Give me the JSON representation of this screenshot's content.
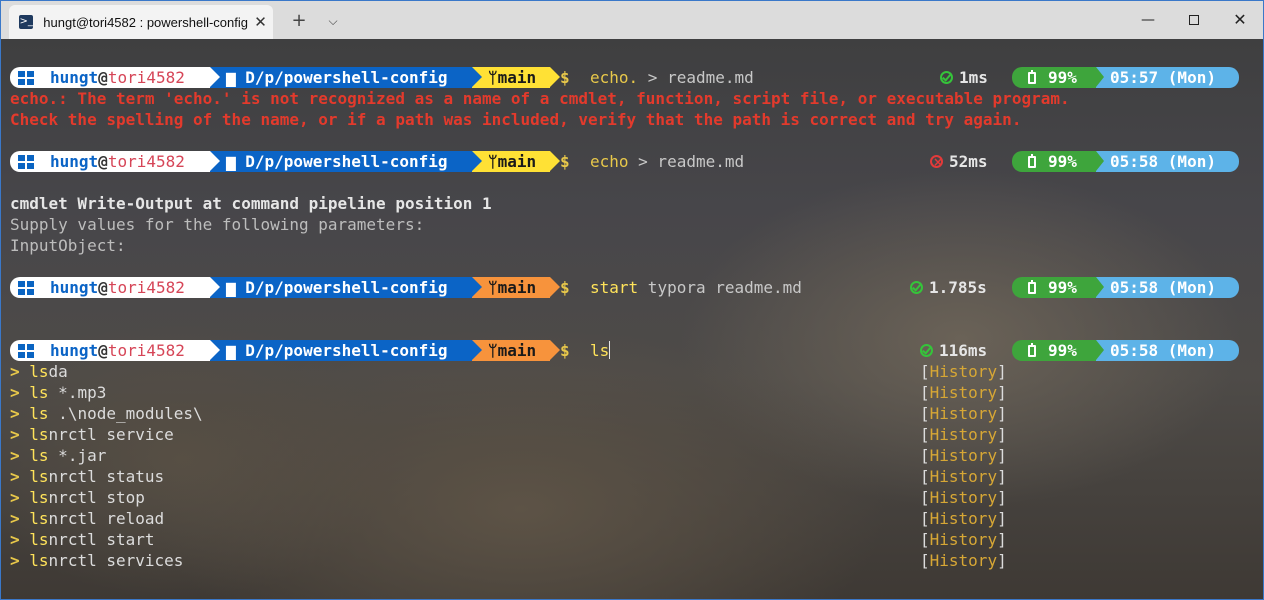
{
  "window": {
    "tab_title": "hungt@tori4582 : powershell-config",
    "tab_icon": "powershell-icon",
    "new_tab": "+",
    "dropdown": "⌵",
    "minimize": "—",
    "close": "✕"
  },
  "prompt": {
    "user": "hungt",
    "at": "@",
    "host": "tori4582",
    "path": "D/p/powershell-config",
    "branch": "main",
    "dollar": "$"
  },
  "colors": {
    "path_bg": "#0b64c6",
    "git_yellow": "#ffe135",
    "git_orange": "#f7933c",
    "battery_bg": "#3ea53c",
    "time_bg": "#5db3e8",
    "error_red": "#e33a2c"
  },
  "commands": [
    {
      "cmd": "echo.",
      "args": " > readme.md",
      "status": "ok",
      "duration": "1ms",
      "battery": "99%",
      "time": "05:57 (Mon)",
      "git_state": "clean"
    },
    {
      "cmd": "echo",
      "args": " > readme.md",
      "status": "error",
      "duration": "52ms",
      "battery": "99%",
      "time": "05:58 (Mon)",
      "git_state": "clean"
    },
    {
      "cmd": "start",
      "args": " typora readme.md",
      "status": "ok",
      "duration": "1.785s",
      "battery": "99%",
      "time": "05:58 (Mon)",
      "git_state": "modified"
    },
    {
      "cmd": "ls",
      "args": "",
      "status": "ok",
      "duration": "116ms",
      "battery": "99%",
      "time": "05:58 (Mon)",
      "git_state": "modified"
    }
  ],
  "errors": [
    "echo.: The term 'echo.' is not recognized as a name of a cmdlet, function, script file, or executable program.",
    "Check the spelling of the name, or if a path was included, verify that the path is correct and try again."
  ],
  "output": {
    "line1": "cmdlet Write-Output at command pipeline position 1",
    "line2": "Supply values for the following parameters:",
    "line3": "InputObject:"
  },
  "suggestions": {
    "chevron": ">",
    "source_open": "[",
    "source_label": "History",
    "source_close": "]",
    "items": [
      {
        "match": "ls",
        "rest": "da"
      },
      {
        "match": "ls",
        "rest": " *.mp3"
      },
      {
        "match": "ls",
        "rest": " .\\node_modules\\"
      },
      {
        "match": "ls",
        "rest": "nrctl service"
      },
      {
        "match": "ls",
        "rest": " *.jar"
      },
      {
        "match": "ls",
        "rest": "nrctl status"
      },
      {
        "match": "ls",
        "rest": "nrctl stop"
      },
      {
        "match": "ls",
        "rest": "nrctl reload"
      },
      {
        "match": "ls",
        "rest": "nrctl start"
      },
      {
        "match": "ls",
        "rest": "nrctl services"
      }
    ]
  }
}
